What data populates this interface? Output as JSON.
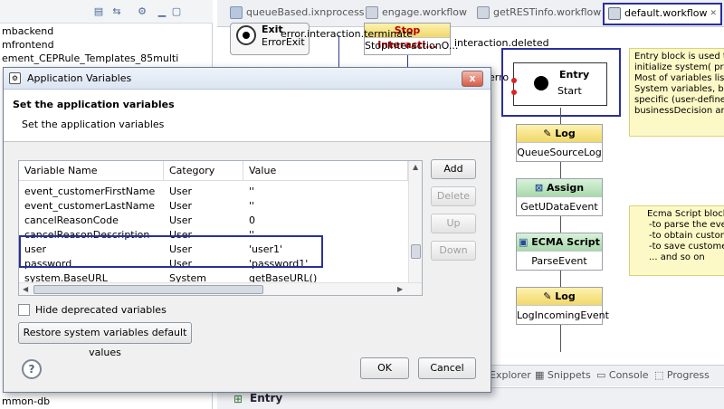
{
  "left_tree": {
    "items": [
      "mbackend",
      "mfrontend",
      "ement_CEPRule_Templates_85multi",
      "mmon-db"
    ]
  },
  "editor_tabs": [
    {
      "label": "queueBased.ixnprocess"
    },
    {
      "label": "engage.workflow"
    },
    {
      "label": "getRESTinfo.workflow"
    },
    {
      "label": "default.workflow",
      "close": "✕"
    }
  ],
  "canvas": {
    "exit_node": {
      "title": "Exit",
      "body": "ErrorExit"
    },
    "stop_node": {
      "title": "Stop Interacti...",
      "body": "StopInteractionO..."
    },
    "error_label": "error.interaction.terminate",
    "deleted_label": "interaction.deleted",
    "partial_label": "erro",
    "entry_node": {
      "title": "Entry",
      "body": "Start"
    },
    "log1": {
      "title": "Log",
      "body": "QueueSourceLog"
    },
    "assign": {
      "title": "Assign",
      "body": "GetUDataEvent"
    },
    "ecma": {
      "title": "ECMA Script",
      "body": "ParseEvent"
    },
    "log2": {
      "title": "Log",
      "body": "LogIncomingEvent"
    },
    "note_entry": [
      "Entry block is used to be",
      "initialize system( predefi",
      "Most of variables listed u",
      "System variables, but th",
      "specific (user-defined) s",
      "businessDecision and ma"
    ],
    "note_ecma": [
      "Ecma Script block",
      "-to parse the eve",
      "-to obtain custom",
      "-to save custome",
      "... and so on"
    ]
  },
  "bottom_views": {
    "explorer": "Explorer",
    "snippets": "Snippets",
    "console": "Console",
    "progress": "Progress"
  },
  "bottom_bar": {
    "title": "Entry"
  },
  "dialog": {
    "title": "Application Variables",
    "header_title": "Set the application variables",
    "header_subtitle": "Set the application variables",
    "columns": [
      "Variable Name",
      "Category",
      "Value"
    ],
    "rows": [
      {
        "name": "event_customerFirstName",
        "category": "User",
        "value": "''"
      },
      {
        "name": "event_customerLastName",
        "category": "User",
        "value": "''"
      },
      {
        "name": "cancelReasonCode",
        "category": "User",
        "value": "0"
      },
      {
        "name": "cancelReasonDescription",
        "category": "User",
        "value": "''"
      },
      {
        "name": "user",
        "category": "User",
        "value": "'user1'"
      },
      {
        "name": "password",
        "category": "User",
        "value": "'password1'"
      },
      {
        "name": "system.BaseURL",
        "category": "System",
        "value": "getBaseURL()"
      }
    ],
    "buttons": {
      "add": "Add",
      "delete": "Delete",
      "up": "Up",
      "down": "Down",
      "restore": "Restore system variables default values",
      "ok": "OK",
      "cancel": "Cancel"
    },
    "hide_deprecated_label": "Hide deprecated variables",
    "hide_deprecated_checked": false,
    "close_glyph": "x",
    "help_glyph": "?"
  },
  "colors": {
    "highlight": "#2a2f9c",
    "log_header": "#f1d86a",
    "assign_header": "#a8d9ab",
    "note_bg": "#fdf9c6"
  }
}
